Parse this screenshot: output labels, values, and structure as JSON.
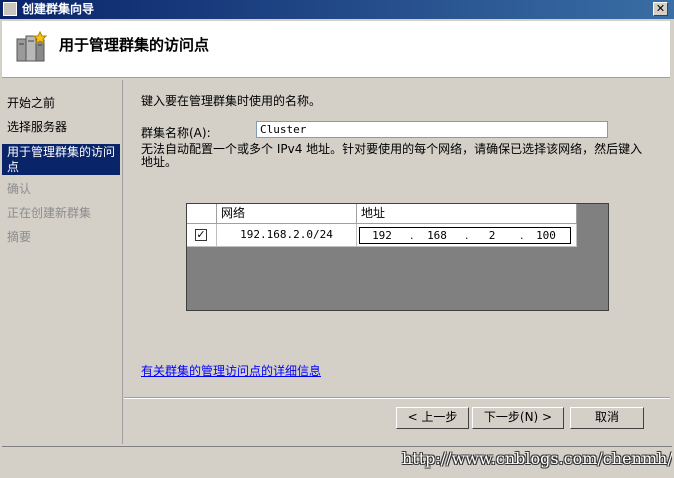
{
  "window": {
    "title": "创建群集向导",
    "close_symbol": "✕"
  },
  "header": {
    "title": "用于管理群集的访问点",
    "icon": "cluster-server-icon"
  },
  "nav": {
    "items": [
      {
        "label": "开始之前",
        "state": "normal"
      },
      {
        "label": "选择服务器",
        "state": "normal"
      },
      {
        "label": "用于管理群集的访问点",
        "state": "active"
      },
      {
        "label": "确认",
        "state": "disabled"
      },
      {
        "label": "正在创建新群集",
        "state": "disabled"
      },
      {
        "label": "摘要",
        "state": "disabled"
      }
    ]
  },
  "main": {
    "instruction": "键入要在管理群集时使用的名称。",
    "name_label": "群集名称(A):",
    "name_value": "Cluster",
    "network_note": "无法自动配置一个或多个 IPv4 地址。针对要使用的每个网络，请确保已选择该网络，然后键入地址。",
    "grid": {
      "headers": [
        "网络",
        "地址"
      ],
      "rows": [
        {
          "checked": true,
          "check_symbol": "✓",
          "network": "192.168.2.0/24",
          "address": [
            "192",
            "168",
            "2",
            "100"
          ]
        }
      ]
    },
    "detail_link": "有关群集的管理访问点的详细信息"
  },
  "buttons": {
    "prev": "< 上一步",
    "next": "下一步(N) >",
    "cancel": "取消"
  },
  "watermark": "http://www.cnblogs.com/chenmh/",
  "colors": {
    "titlebar": "#0a246a",
    "selection": "#0a246a",
    "link": "#0000ff"
  }
}
